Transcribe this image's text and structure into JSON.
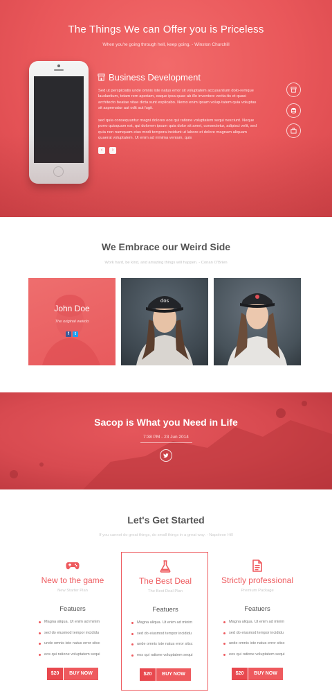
{
  "hero": {
    "title": "The Things We can Offer you is Priceless",
    "quote": "When you're going through hell, keep going. - Winston Churchill",
    "service": {
      "icon": "shop-icon",
      "title": "Business Development",
      "paragraph1": "Sed ut perspiciatis unde omnis iste natus error sit voluptatem accusantium dolo-remque laudantium, totam rem aperiam, eaque ipsa quae ab illo inventore verita-tis et quasi architecto beatae vitae dicta sunt explicabo. Nemo enim ipsam volup-tatem quia voluptas sit aspernatur aut odit aut fugit.",
      "paragraph2": "sed quia consequuntur magni dolores eos qui ratione voluptatem sequi nesciunt. Neque porro quisquam est, qui dolorem ipsum quia dolor sit amet, consectetur, adipisci velit, sed quia non numquam eius modi tempora incidunt ut labore et dolore magnam aliquam quaerat voluptatem. Ut enim ad minima veniam, quis"
    },
    "prev_arrow": "‹",
    "next_arrow": "›",
    "side_icons": [
      "shop-icon",
      "database-icon",
      "briefcase-icon"
    ]
  },
  "team": {
    "title": "We Embrace our Weird Side",
    "quote": "Work hard, be kind, and amazing things will happen. - Conan O'Brien",
    "featured": {
      "name": "John Doe",
      "role": "The original weirdo",
      "social": [
        "f",
        "t"
      ]
    },
    "photos": [
      "woman-in-cap-photo",
      "woman-in-cap-photo"
    ]
  },
  "banner": {
    "title": "Sacop is What you Need in Life",
    "date": "7:38 PM - 23 Jun 2014",
    "icon": "twitter-icon"
  },
  "pricing": {
    "title": "Let's Get Started",
    "quote": "If you cannot do great things, do small things in a great way. - Napoleon Hill",
    "plans": [
      {
        "icon": "gamepad-icon",
        "name": "New to the game",
        "subtitle": "New Starter Plan",
        "features_heading": "Featuers",
        "features": [
          "Magna aliqua. Ut enim ad minim",
          "sed do eiusmod tempor incididu",
          "unde omnis iste natus error sitsc",
          "eos qui ratione voluptatem sequi"
        ],
        "price": "$20",
        "buy": "BUY NOW"
      },
      {
        "icon": "flask-icon",
        "name": "The Best Deal",
        "subtitle": "The Best Deal Plan",
        "features_heading": "Featuers",
        "features": [
          "Magna aliqua. Ut enim ad minim",
          "sed do eiusmod tempor incididu",
          "unde omnis iste natus error sitsc",
          "eos qui ratione voluptatem sequi"
        ],
        "price": "$20",
        "buy": "BUY NOW"
      },
      {
        "icon": "document-icon",
        "name": "Strictly professional",
        "subtitle": "Premium Package",
        "features_heading": "Featuers",
        "features": [
          "Magna aliqua. Ut enim ad minim",
          "sed do eiusmod tempor incididu",
          "unde omnis iste natus error sitsc",
          "eos qui ratione voluptatem sequi"
        ],
        "price": "$20",
        "buy": "BUY NOW"
      }
    ]
  },
  "colors": {
    "accent": "#ee5a5e",
    "hero_bg": "#e9575a",
    "banner_bg": "#d84a50"
  }
}
